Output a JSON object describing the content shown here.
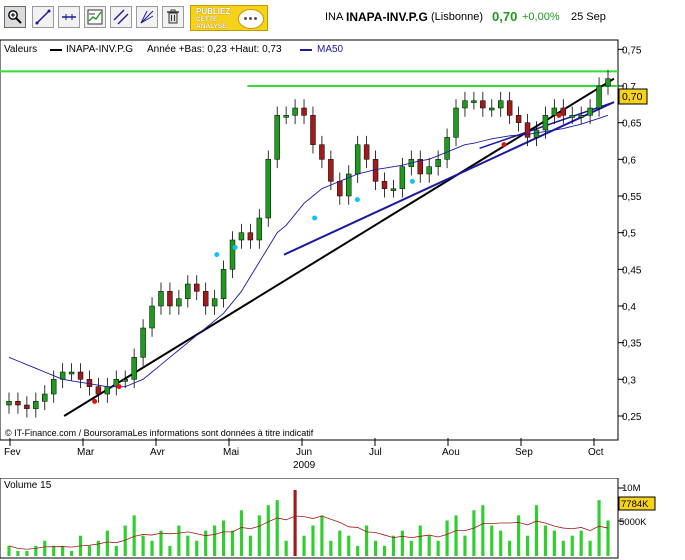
{
  "toolbar": {
    "tools": [
      "zoom-tool",
      "draw-line-tool",
      "horizontal-line-tool",
      "indicator-tool",
      "parallel-lines-tool",
      "fibonacci-tool",
      "trash-tool"
    ],
    "promo_line1": "PUBLIEZ",
    "promo_line2": "CETTE",
    "promo_line3": "ANALYSE"
  },
  "quote": {
    "code": "INA",
    "name": "INAPA-INV.P.G",
    "market": "(Lisbonne)",
    "price": "0,70",
    "change": "+0,00%",
    "date": "25 Sep"
  },
  "legend": {
    "label": "Valeurs",
    "series_name": "INAPA-INV.P.G",
    "stats": "Année +Bas: 0,23 +Haut: 0,73",
    "ma_name": "MA50"
  },
  "copyright": "© IT-Finance.com / BoursoramaLes informations sont données à titre indicatif",
  "colors": {
    "up": "#1f9a1f",
    "down": "#a01c1c",
    "resistance": "#33dd33",
    "support": "#1a1aa0",
    "trend": "#000000",
    "ma": "#1a1aa0"
  },
  "chart_data": [
    {
      "type": "candlestick",
      "title": "",
      "x_ticks": [
        "Fev",
        "Mar",
        "Avr",
        "Mai",
        "Jun",
        "Jul",
        "Aou",
        "Sep",
        "Oct"
      ],
      "x_year": "2009",
      "y_ticks": [
        "0,25",
        "0,3",
        "0,35",
        "0,4",
        "0,45",
        "0,5",
        "0,55",
        "0,6",
        "0,65",
        "0,7",
        "0,75"
      ],
      "ylim": [
        0.22,
        0.76
      ],
      "last_price_label": "0,70",
      "close_series": [
        0.27,
        0.265,
        0.26,
        0.27,
        0.28,
        0.3,
        0.31,
        0.31,
        0.3,
        0.29,
        0.28,
        0.29,
        0.3,
        0.3,
        0.33,
        0.37,
        0.4,
        0.42,
        0.4,
        0.41,
        0.43,
        0.42,
        0.4,
        0.41,
        0.45,
        0.49,
        0.5,
        0.49,
        0.52,
        0.6,
        0.66,
        0.66,
        0.67,
        0.66,
        0.62,
        0.6,
        0.57,
        0.55,
        0.58,
        0.62,
        0.6,
        0.57,
        0.56,
        0.56,
        0.59,
        0.6,
        0.58,
        0.59,
        0.6,
        0.63,
        0.67,
        0.68,
        0.68,
        0.67,
        0.67,
        0.68,
        0.66,
        0.65,
        0.63,
        0.64,
        0.66,
        0.67,
        0.66,
        0.66,
        0.66,
        0.67,
        0.7,
        0.71
      ],
      "ma50_series": [
        0.33,
        0.325,
        0.32,
        0.315,
        0.31,
        0.305,
        0.3,
        0.298,
        0.296,
        0.294,
        0.292,
        0.29,
        0.29,
        0.29,
        0.295,
        0.3,
        0.31,
        0.32,
        0.33,
        0.34,
        0.35,
        0.36,
        0.37,
        0.38,
        0.39,
        0.405,
        0.42,
        0.44,
        0.46,
        0.48,
        0.5,
        0.51,
        0.525,
        0.54,
        0.55,
        0.56,
        0.565,
        0.57,
        0.575,
        0.58,
        0.583,
        0.586,
        0.588,
        0.59,
        0.592,
        0.595,
        0.598,
        0.6,
        0.605,
        0.61,
        0.615,
        0.62,
        0.622,
        0.625,
        0.628,
        0.63,
        0.632,
        0.633,
        0.634,
        0.636,
        0.638,
        0.64,
        0.642,
        0.645,
        0.648,
        0.652,
        0.656,
        0.66
      ],
      "resistance_levels": [
        0.72,
        0.7
      ],
      "support_line": {
        "from": [
          0.46,
          0.47
        ],
        "to": [
          1.0,
          0.678
        ]
      },
      "support_line2": {
        "from": [
          0.78,
          0.615
        ],
        "to": [
          1.0,
          0.678
        ]
      },
      "trend_line": {
        "from": [
          0.1,
          0.25
        ],
        "to": [
          1.0,
          0.71
        ]
      }
    },
    {
      "type": "bar",
      "title": "Volume 15",
      "y_ticks": [
        "10M",
        "5000K"
      ],
      "last_value_label": "7784K"
    }
  ]
}
